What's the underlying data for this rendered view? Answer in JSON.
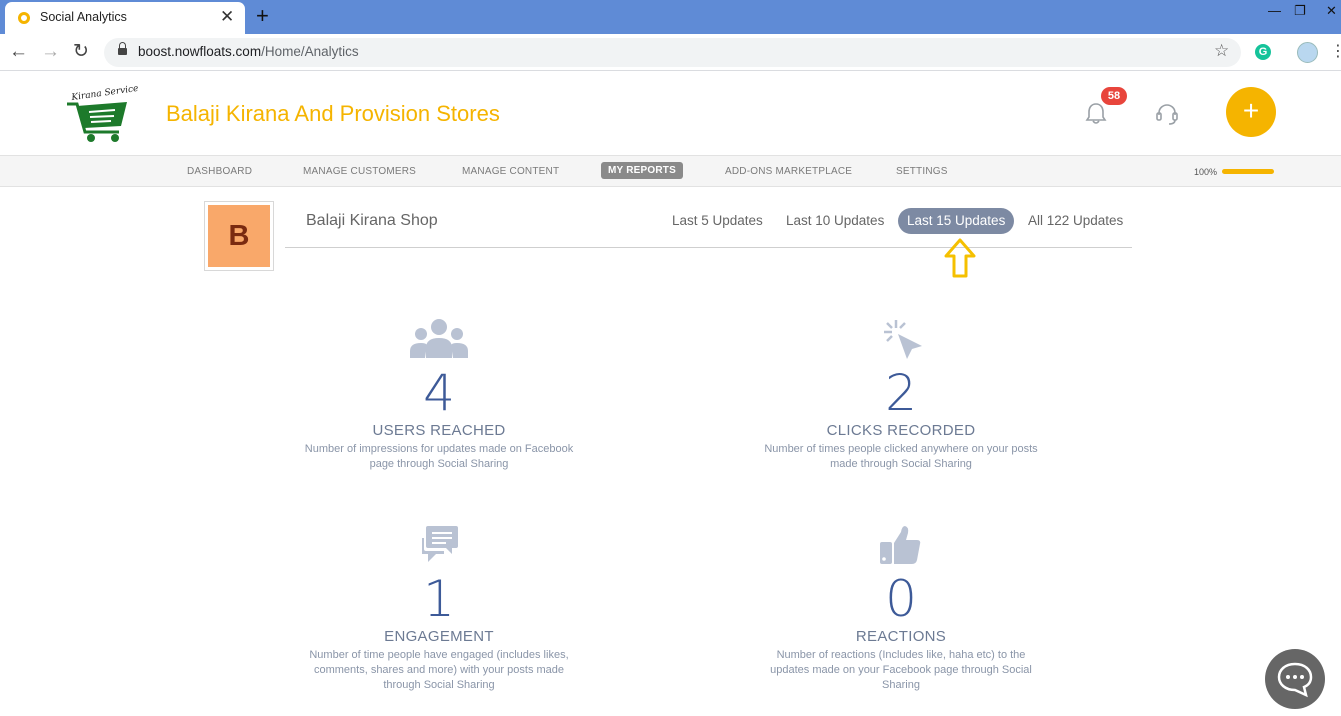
{
  "browser": {
    "tab_title": "Social Analytics",
    "url_host": "boost.nowfloats.com",
    "url_path": "/Home/Analytics"
  },
  "header": {
    "brand_name": "Balaji Kirana And Provision Stores",
    "logo_text": "Kirana Service",
    "notification_count": "58"
  },
  "nav": {
    "items": [
      "DASHBOARD",
      "MANAGE CUSTOMERS",
      "MANAGE CONTENT",
      "MY REPORTS",
      "ADD-ONS MARKETPLACE",
      "SETTINGS"
    ],
    "active": "MY REPORTS",
    "progress_label": "100%",
    "progress_value": 1.0
  },
  "profile": {
    "avatar_letter": "B",
    "shop_name": "Balaji Kirana Shop",
    "filters": [
      "Last 5 Updates",
      "Last 10 Updates",
      "Last 15 Updates",
      "All 122 Updates"
    ],
    "active_filter": "Last 15 Updates"
  },
  "metrics": [
    {
      "icon": "users-icon",
      "value": "4",
      "title": "USERS REACHED",
      "description": "Number of impressions for updates made on Facebook page through Social Sharing"
    },
    {
      "icon": "click-icon",
      "value": "2",
      "title": "CLICKS RECORDED",
      "description": "Number of times people clicked anywhere on your posts made through Social Sharing"
    },
    {
      "icon": "chat-bubbles-icon",
      "value": "1",
      "title": "ENGAGEMENT",
      "description": "Number of time people have engaged (includes likes, comments, shares and more) with your posts made through Social Sharing"
    },
    {
      "icon": "thumbs-up-icon",
      "value": "0",
      "title": "REACTIONS",
      "description": "Number of reactions (Includes like, haha etc) to the updates made on your Facebook page through Social Sharing"
    }
  ],
  "colors": {
    "brand": "#f5b400",
    "accent_blue": "#3d5a98",
    "filter_active": "#7d8aa3",
    "badge": "#e8453c"
  }
}
